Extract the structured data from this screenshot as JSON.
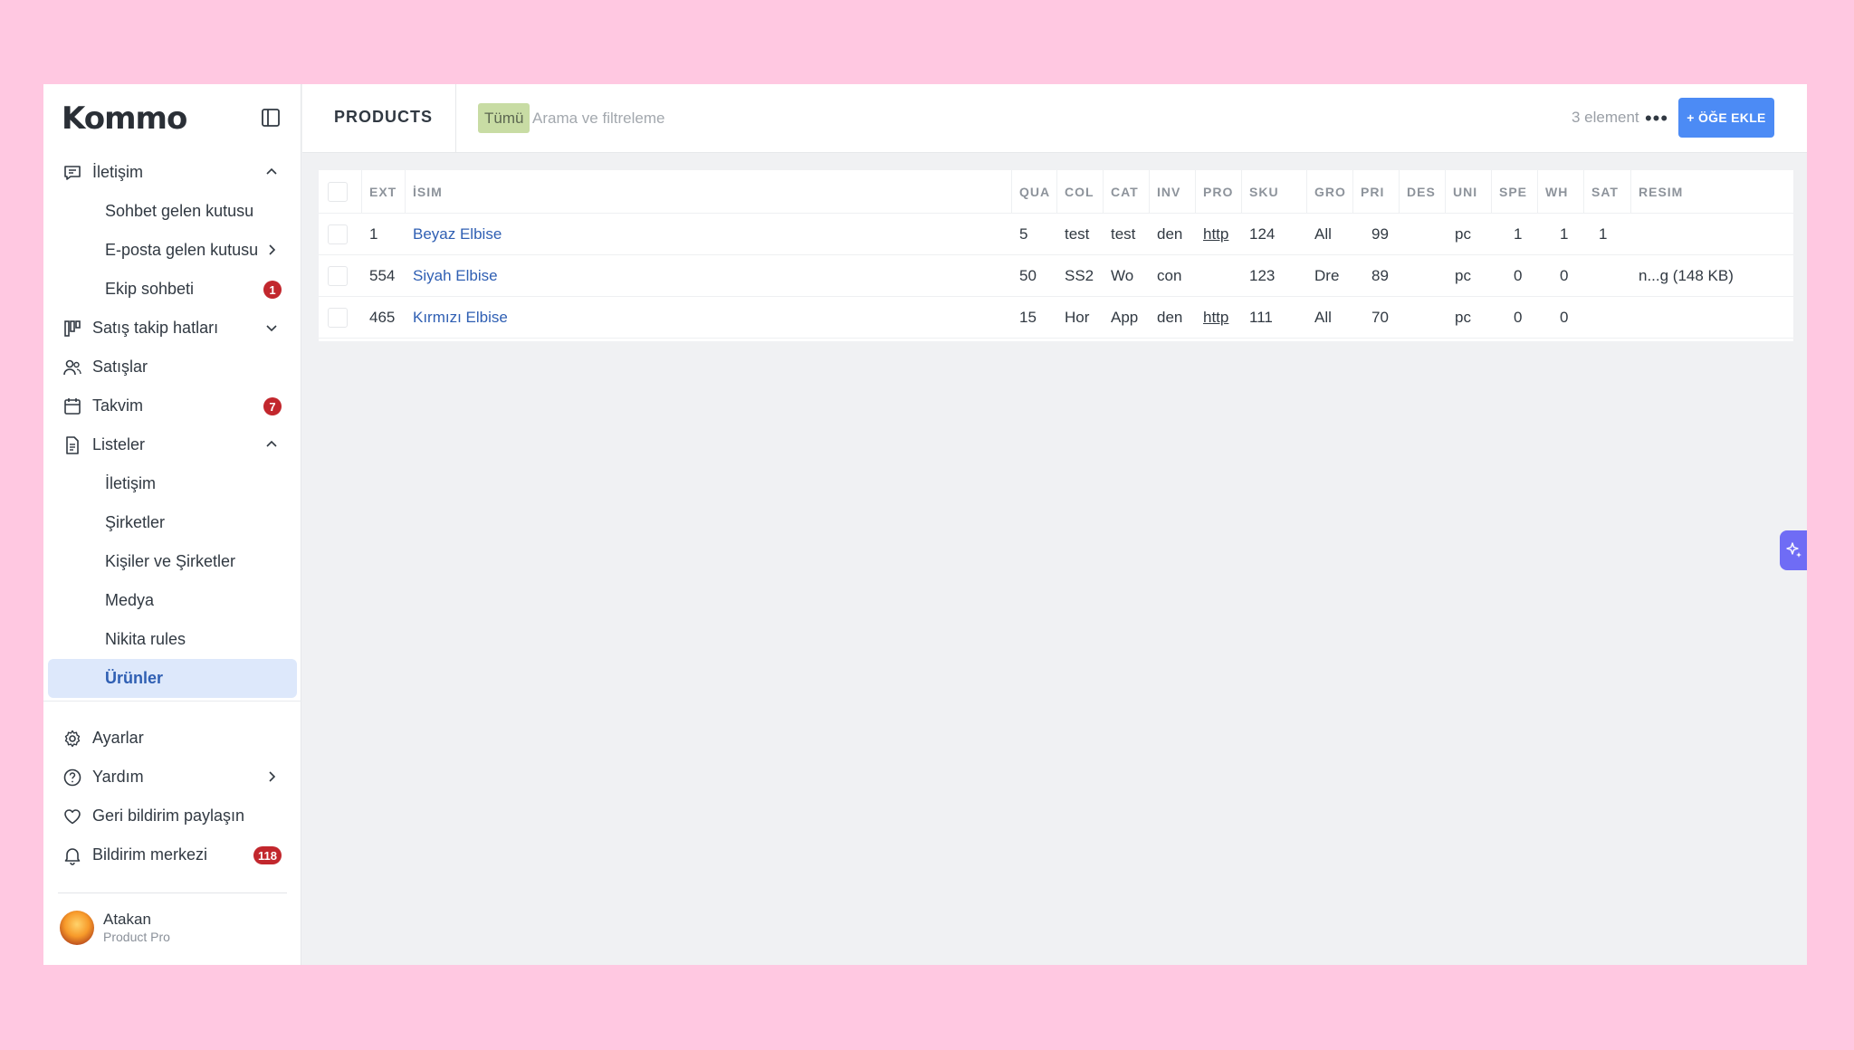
{
  "app": {
    "logo": "Kommo"
  },
  "sidebar": {
    "items": [
      {
        "label": "İletişim",
        "icon": "chat-icon",
        "chevron": "up"
      },
      {
        "label": "Sohbet gelen kutusu",
        "sub": true
      },
      {
        "label": "E-posta gelen kutusu",
        "sub": true,
        "chevron": "right"
      },
      {
        "label": "Ekip sohbeti",
        "sub": true,
        "badge": "1"
      },
      {
        "label": "Satış takip hatları",
        "icon": "pipeline-icon",
        "chevron": "down"
      },
      {
        "label": "Satışlar",
        "icon": "users-icon"
      },
      {
        "label": "Takvim",
        "icon": "calendar-icon",
        "badge": "7"
      },
      {
        "label": "Listeler",
        "icon": "document-icon",
        "chevron": "up"
      },
      {
        "label": "İletişim",
        "sub": true
      },
      {
        "label": "Şirketler",
        "sub": true
      },
      {
        "label": "Kişiler ve Şirketler",
        "sub": true
      },
      {
        "label": "Medya",
        "sub": true
      },
      {
        "label": "Nikita rules",
        "sub": true
      },
      {
        "label": "Ürünler",
        "sub": true,
        "active": true
      }
    ],
    "bottom_items": [
      {
        "label": "Ayarlar",
        "icon": "gear-icon"
      },
      {
        "label": "Yardım",
        "icon": "help-icon",
        "chevron": "right"
      },
      {
        "label": "Geri bildirim paylaşın",
        "icon": "heart-icon"
      },
      {
        "label": "Bildirim merkezi",
        "icon": "bell-icon",
        "badge": "118"
      }
    ],
    "user": {
      "name": "Atakan",
      "plan": "Product Pro"
    }
  },
  "header": {
    "title": "PRODUCTS",
    "filter_tag": "Tümü",
    "search_placeholder": "Arama ve filtreleme",
    "count": "3 element",
    "add_button": "+ ÖĞE EKLE"
  },
  "table": {
    "columns": [
      "EXT",
      "İSIM",
      "QUA",
      "COL",
      "CAT",
      "INV",
      "PRO",
      "SKU",
      "GRO",
      "PRI",
      "DES",
      "UNI",
      "SPE",
      "WH",
      "SAT",
      "RESIM"
    ],
    "rows": [
      {
        "ext": "1",
        "name": "Beyaz Elbise",
        "qua": "5",
        "col": "test",
        "cat": "test",
        "inv": "den",
        "pro": "http",
        "sku": "124",
        "gro": "All",
        "pri": "99",
        "des": "",
        "uni": "pc",
        "spe": "1",
        "wh": "1",
        "sat": "1",
        "resim": ""
      },
      {
        "ext": "554",
        "name": "Siyah Elbise",
        "qua": "50",
        "col": "SS2",
        "cat": "Wo",
        "inv": "con",
        "pro": "",
        "sku": "123",
        "gro": "Dre",
        "pri": "89",
        "des": "",
        "uni": "pc",
        "spe": "0",
        "wh": "0",
        "sat": "",
        "resim": "n...g (148 KB)"
      },
      {
        "ext": "465",
        "name": "Kırmızı Elbise",
        "qua": "15",
        "col": "Hor",
        "cat": "App",
        "inv": "den",
        "pro": "http",
        "sku": "111",
        "gro": "All",
        "pri": "70",
        "des": "",
        "uni": "pc",
        "spe": "0",
        "wh": "0",
        "sat": "",
        "resim": ""
      }
    ]
  },
  "colors": {
    "accent": "#4c8bf5",
    "badge": "#c2272d",
    "active_bg": "#dde8fb",
    "link": "#2f5fb3"
  }
}
